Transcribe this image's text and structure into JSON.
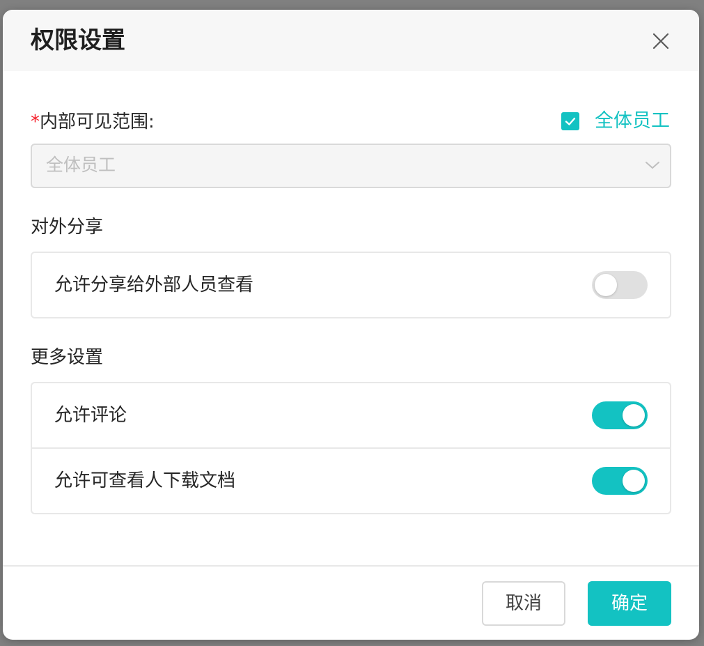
{
  "dialog": {
    "title": "权限设置"
  },
  "visibility": {
    "required_mark": "*",
    "label": "内部可见范围:",
    "all_staff_checked": true,
    "all_staff_label": "全体员工",
    "select_value": "全体员工"
  },
  "external_share": {
    "section_title": "对外分享",
    "rows": [
      {
        "label": "允许分享给外部人员查看",
        "enabled": false
      }
    ]
  },
  "more_settings": {
    "section_title": "更多设置",
    "rows": [
      {
        "label": "允许评论",
        "enabled": true
      },
      {
        "label": "允许可查看人下载文档",
        "enabled": true
      }
    ]
  },
  "footer": {
    "cancel_label": "取消",
    "ok_label": "确定"
  },
  "colors": {
    "accent": "#13c2c2",
    "required": "#f5222d",
    "switch_off": "#e0e0e0"
  },
  "icons": {
    "close": "close-icon",
    "check": "check-icon",
    "dropdown": "chevron-down-icon"
  }
}
